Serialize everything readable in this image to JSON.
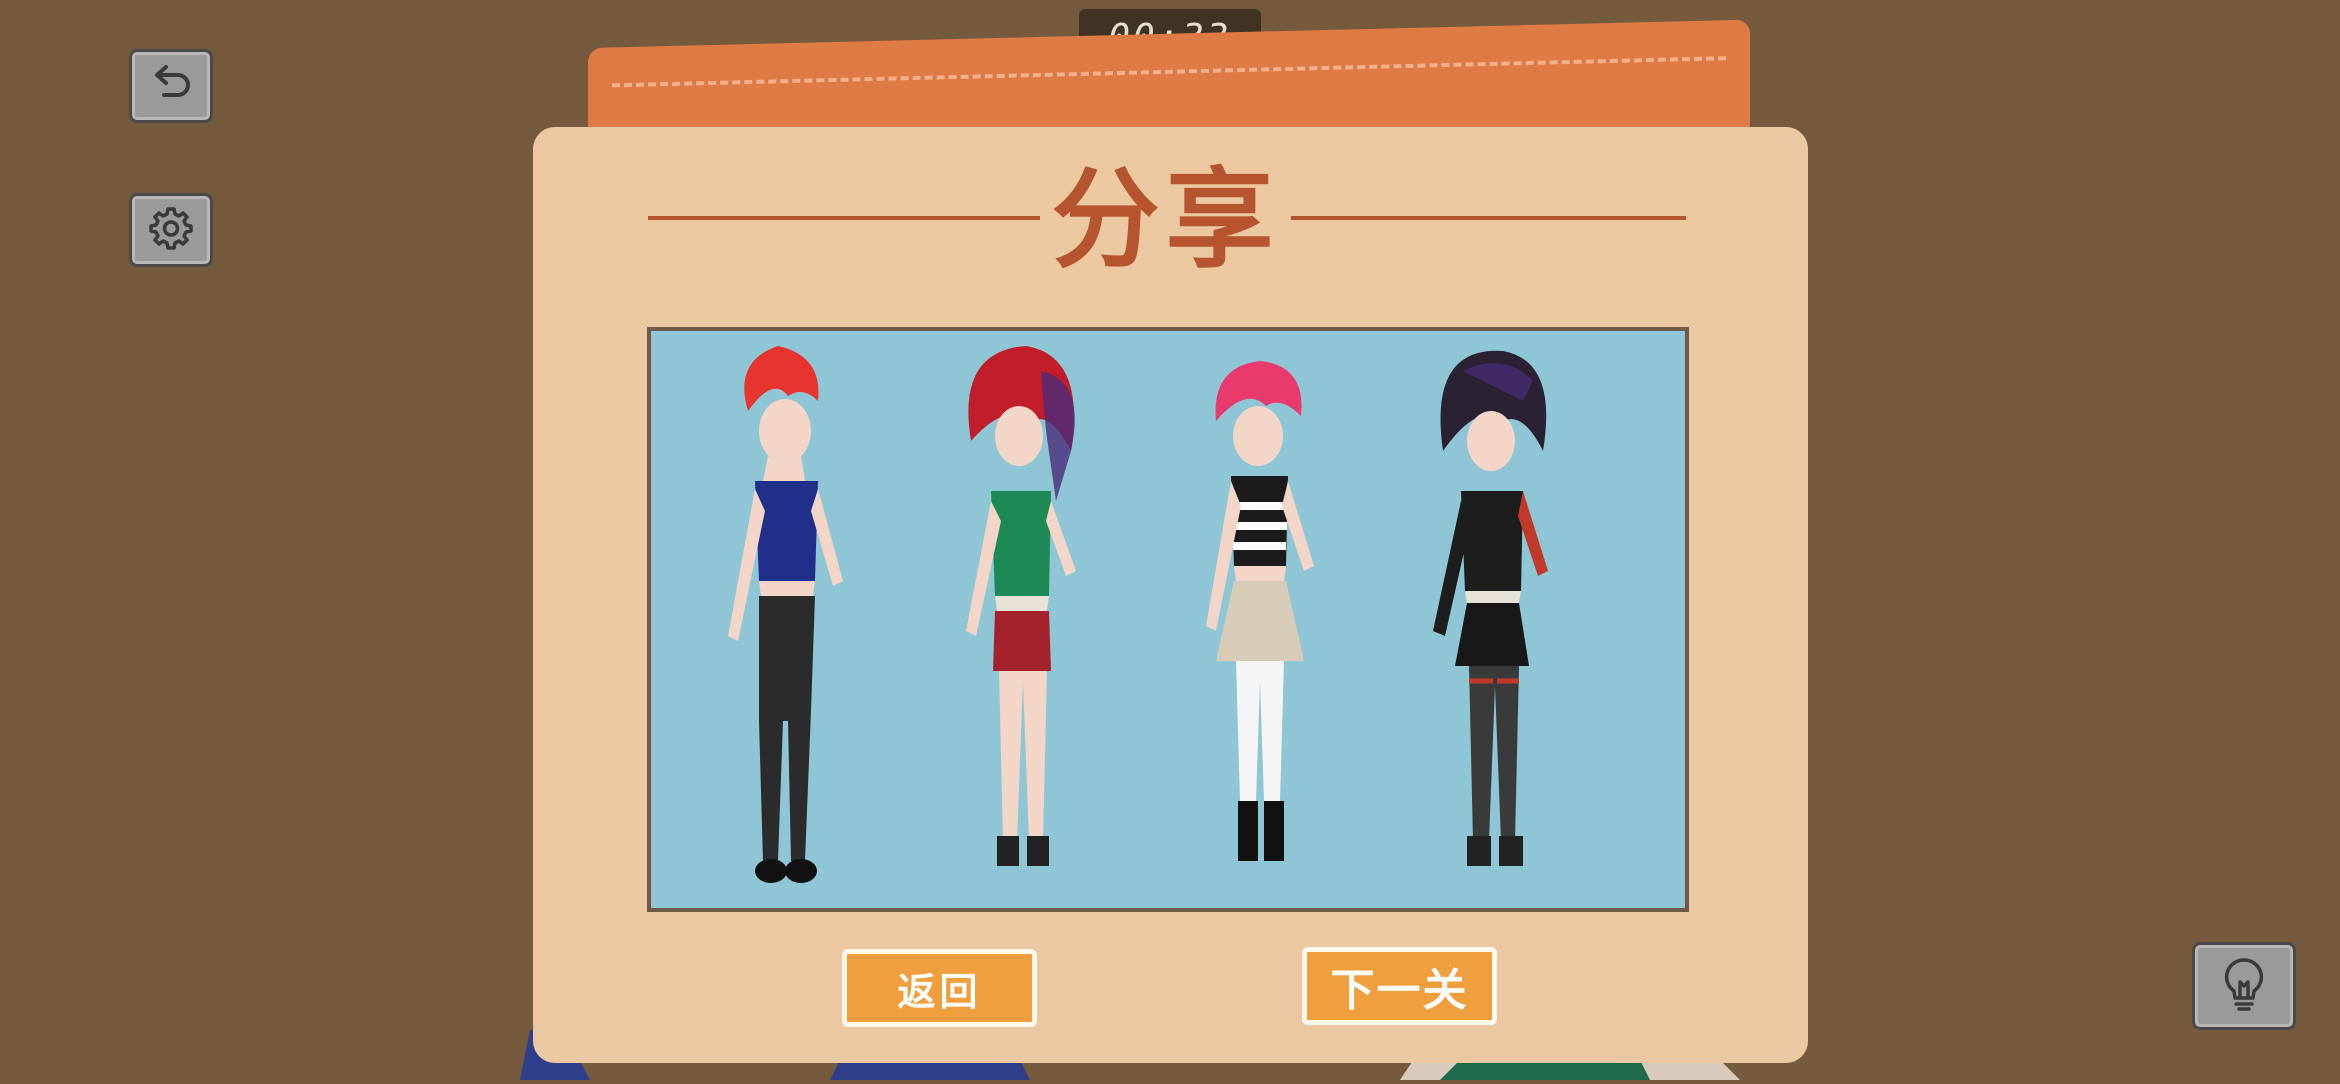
{
  "hud": {
    "timer": "00:33",
    "undo_icon": "undo-icon",
    "settings_icon": "gear-icon",
    "hint_icon": "lightbulb-icon"
  },
  "dialog": {
    "title": "分享",
    "back_label": "返回",
    "next_label": "下一关"
  },
  "colors": {
    "background": "#765a3e",
    "panel": "#ecc8a2",
    "title": "#b6542f",
    "button": "#ef9f3d",
    "image_bg": "#8ec6d5"
  },
  "characters": [
    {
      "hair": "#e8342e",
      "top": "#1f2f8a",
      "bottom": "#2b2b2b"
    },
    {
      "hair": "#c21d2a",
      "top": "#1d8a55",
      "bottom": "#a3222b"
    },
    {
      "hair": "#e83a6c",
      "top": "#1b1b1b",
      "bottom": "#d8ccb8"
    },
    {
      "hair": "#2a2233",
      "top": "#1d1d1d",
      "bottom": "#181818"
    }
  ]
}
